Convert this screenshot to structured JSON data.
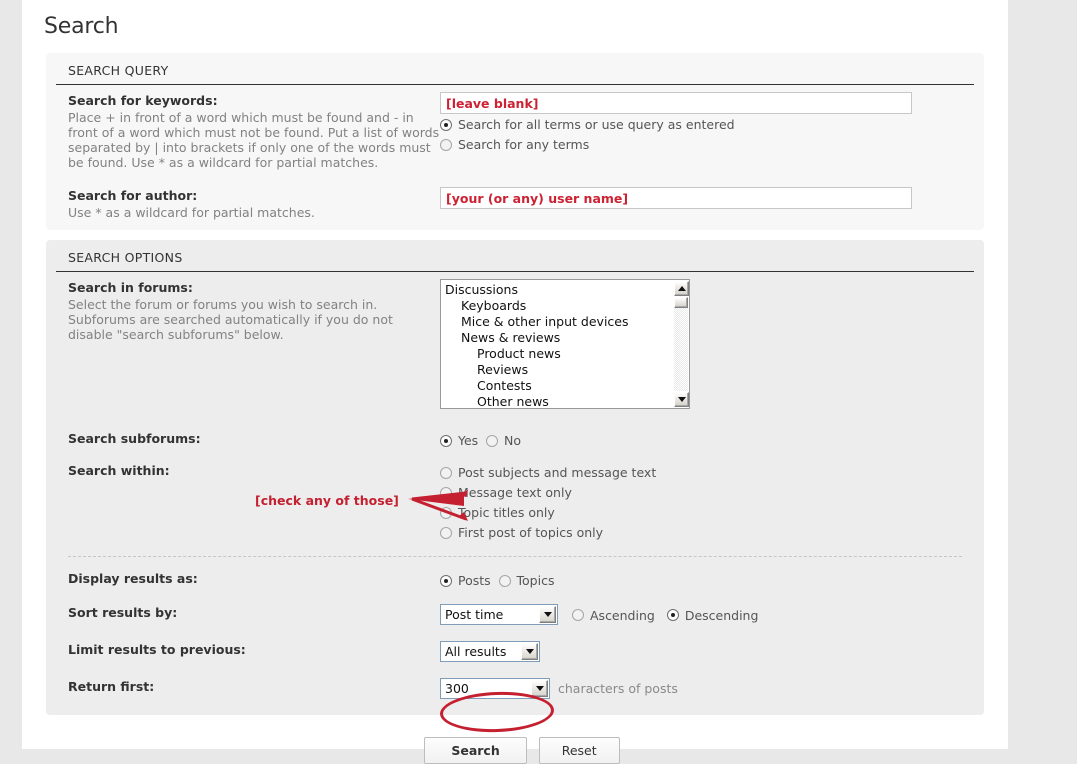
{
  "page": {
    "title": "Search"
  },
  "query_section": {
    "legend": "SEARCH QUERY",
    "keywords": {
      "label": "Search for keywords:",
      "description": "Place + in front of a word which must be found and - in front of a word which must not be found. Put a list of words separated by | into brackets if only one of the words must be found. Use * as a wildcard for partial matches.",
      "input_value": "[leave blank]",
      "placeholder": "[leave blank]",
      "options": [
        {
          "label": "Search for all terms or use query as entered",
          "checked": true
        },
        {
          "label": "Search for any terms",
          "checked": false
        }
      ]
    },
    "author": {
      "label": "Search for author:",
      "description": "Use * as a wildcard for partial matches.",
      "input_value": "[your (or any) user name]",
      "placeholder": "[your (or any) user name]"
    }
  },
  "options_section": {
    "legend": "SEARCH OPTIONS",
    "forums": {
      "label": "Search in forums:",
      "description": "Select the forum or forums you wish to search in. Subforums are searched automatically if you do not disable \"search subforums\" below.",
      "items": [
        {
          "label": "Discussions",
          "indent": 0
        },
        {
          "label": "Keyboards",
          "indent": 1
        },
        {
          "label": "Mice & other input devices",
          "indent": 1
        },
        {
          "label": "News & reviews",
          "indent": 1
        },
        {
          "label": "Product news",
          "indent": 2
        },
        {
          "label": "Reviews",
          "indent": 2
        },
        {
          "label": "Contests",
          "indent": 2
        },
        {
          "label": "Other news",
          "indent": 2
        }
      ]
    },
    "subforums": {
      "label": "Search subforums:",
      "options": [
        {
          "label": "Yes",
          "checked": true
        },
        {
          "label": "No",
          "checked": false
        }
      ]
    },
    "search_within": {
      "label": "Search within:",
      "options": [
        {
          "label": "Post subjects and message text",
          "checked": false
        },
        {
          "label": "Message text only",
          "checked": false
        },
        {
          "label": "Topic titles only",
          "checked": false
        },
        {
          "label": "First post of topics only",
          "checked": false
        }
      ]
    },
    "display_as": {
      "label": "Display results as:",
      "options": [
        {
          "label": "Posts",
          "checked": true
        },
        {
          "label": "Topics",
          "checked": false
        }
      ]
    },
    "sort_by": {
      "label": "Sort results by:",
      "selected": "Post time",
      "direction": [
        {
          "label": "Ascending",
          "checked": false
        },
        {
          "label": "Descending",
          "checked": true
        }
      ]
    },
    "limit_previous": {
      "label": "Limit results to previous:",
      "selected": "All results"
    },
    "return_first": {
      "label": "Return first:",
      "selected": "300",
      "suffix": "characters of posts"
    }
  },
  "buttons": {
    "search": "Search",
    "reset": "Reset"
  },
  "annotations": {
    "check_any": "[check any of those]",
    "color": "#c42030"
  }
}
